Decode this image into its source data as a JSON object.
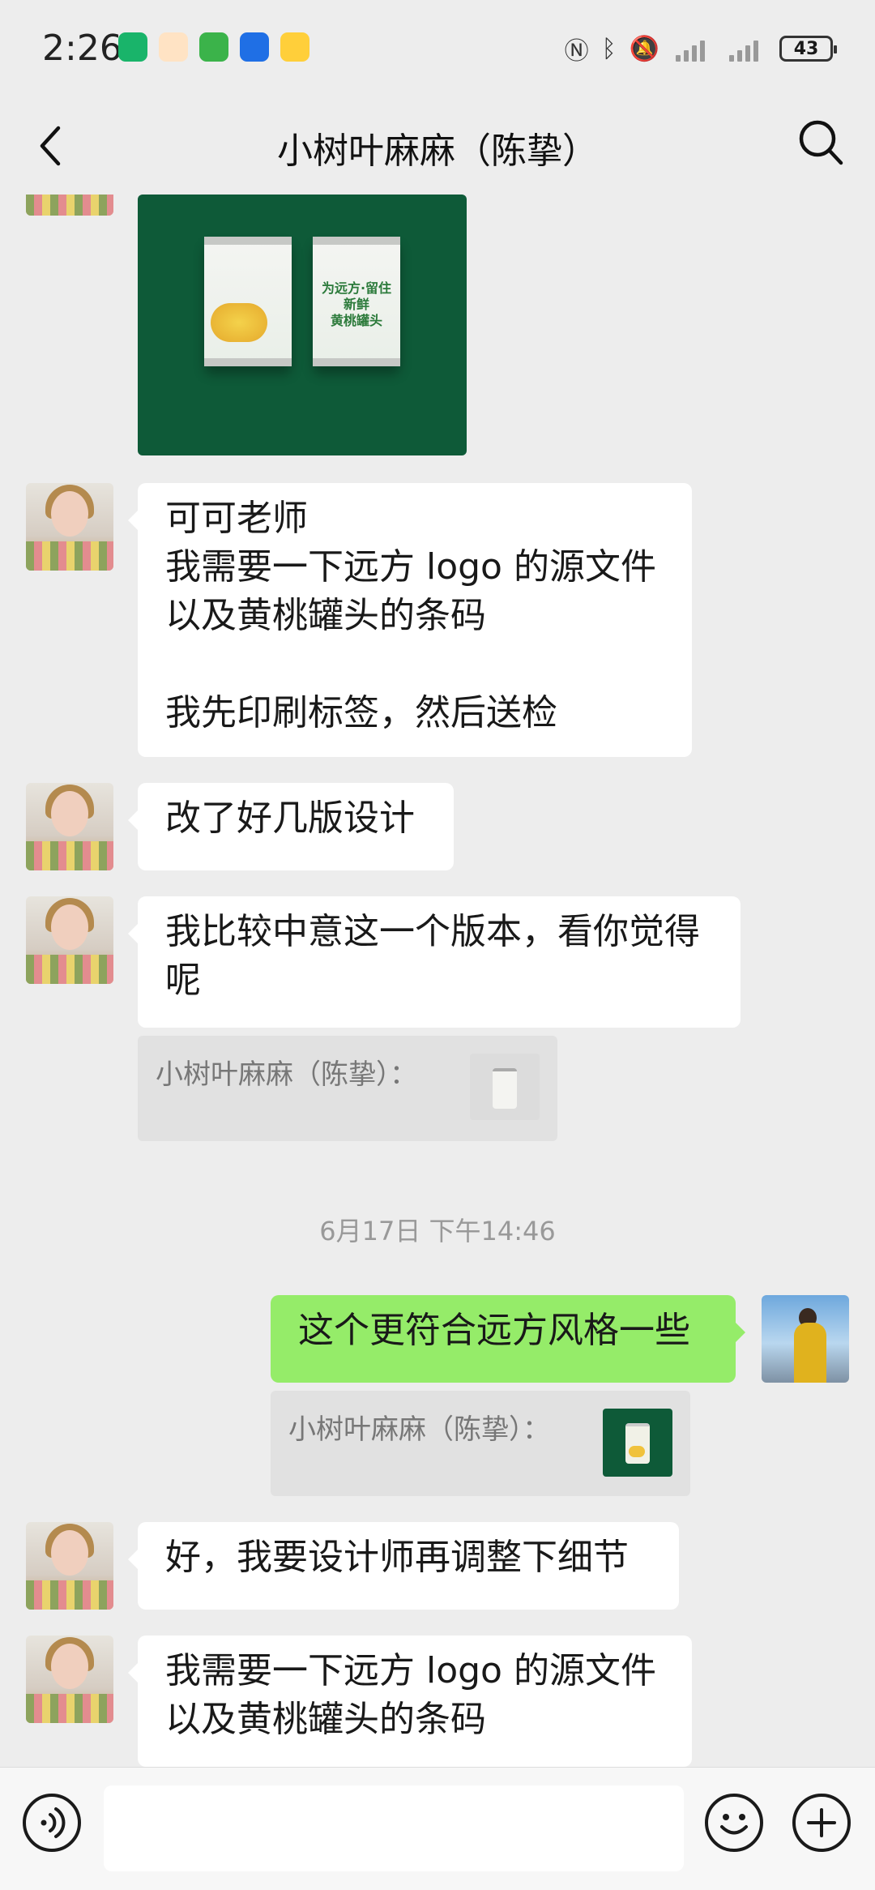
{
  "status_bar": {
    "time": "2:26",
    "battery": "43"
  },
  "nav": {
    "title": "小树叶麻麻（陈挚）"
  },
  "image_message": {
    "can_label": "为远方·留住新鲜\n黄桃罐头"
  },
  "messages": [
    {
      "sender": "other",
      "text": "可可老师\n我需要一下远方 logo 的源文件\n以及黄桃罐头的条码\n\n我先印刷标签，然后送检"
    },
    {
      "sender": "other",
      "text": "改了好几版设计"
    },
    {
      "sender": "other",
      "text": "我比较中意这一个版本，看你觉得\n呢"
    },
    {
      "sender": "me",
      "text": "这个更符合远方风格一些"
    },
    {
      "sender": "other",
      "text": "好，我要设计师再调整下细节"
    },
    {
      "sender": "other",
      "text": "我需要一下远方 logo 的源文件\n以及黄桃罐头的条码"
    }
  ],
  "quotes": [
    {
      "text": "小树叶麻麻（陈挚）："
    },
    {
      "text": "小树叶麻麻（陈挚）："
    }
  ],
  "timestamp": "6月17日 下午14:46",
  "colors": {
    "background": "#ededed",
    "my_bubble": "#95ec69",
    "other_bubble": "#ffffff"
  },
  "icons": [
    "back-arrow-icon",
    "search-icon",
    "voice-icon",
    "emoji-icon",
    "plus-icon"
  ]
}
